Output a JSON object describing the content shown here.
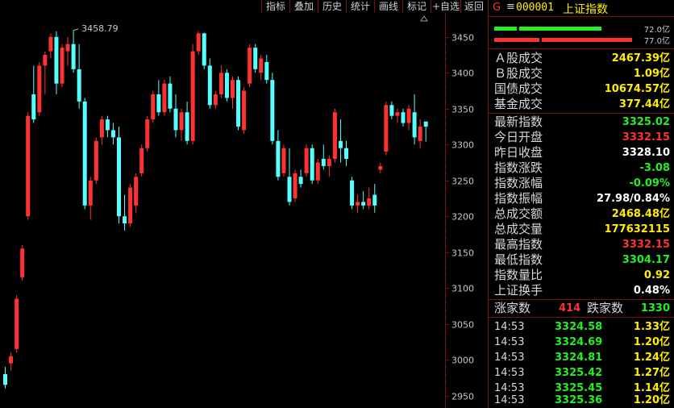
{
  "toolbar": {
    "buttons": [
      "指标",
      "叠加",
      "历史",
      "统计",
      "画线",
      "标记",
      "+自选",
      "返回"
    ]
  },
  "chart": {
    "annotation": "3458.79",
    "axis_labels": [
      "3450",
      "3400",
      "3350",
      "3300",
      "3250",
      "3200",
      "3150",
      "3100",
      "3050",
      "3000",
      "2950"
    ],
    "colors": {
      "up": "#ff3232",
      "down": "#54ffff",
      "grid": "#7a1010",
      "axis_text": "#c8c8c8"
    }
  },
  "chart_data": {
    "type": "candlestick",
    "ylim": [
      2935,
      3470
    ],
    "y_ticks": [
      3450,
      3400,
      3350,
      3300,
      3250,
      3200,
      3150,
      3100,
      3050,
      2950,
      3000
    ],
    "candles": [
      {
        "o": 2980,
        "h": 2990,
        "l": 2960,
        "c": 2965
      },
      {
        "o": 2995,
        "h": 3010,
        "l": 2985,
        "c": 3005
      },
      {
        "o": 3015,
        "h": 3090,
        "l": 3010,
        "c": 3085
      },
      {
        "o": 3115,
        "h": 3160,
        "l": 3110,
        "c": 3155
      },
      {
        "o": 3200,
        "h": 3345,
        "l": 3195,
        "c": 3340
      },
      {
        "o": 3370,
        "h": 3410,
        "l": 3330,
        "c": 3335
      },
      {
        "o": 3345,
        "h": 3415,
        "l": 3340,
        "c": 3410
      },
      {
        "o": 3410,
        "h": 3430,
        "l": 3370,
        "c": 3425
      },
      {
        "o": 3430,
        "h": 3455,
        "l": 3420,
        "c": 3450
      },
      {
        "o": 3450,
        "h": 3458,
        "l": 3370,
        "c": 3385
      },
      {
        "o": 3385,
        "h": 3440,
        "l": 3380,
        "c": 3435
      },
      {
        "o": 3430,
        "h": 3450,
        "l": 3410,
        "c": 3440
      },
      {
        "o": 3440,
        "h": 3459,
        "l": 3400,
        "c": 3405
      },
      {
        "o": 3405,
        "h": 3440,
        "l": 3350,
        "c": 3360
      },
      {
        "o": 3360,
        "h": 3365,
        "l": 3210,
        "c": 3215
      },
      {
        "o": 3215,
        "h": 3255,
        "l": 3195,
        "c": 3250
      },
      {
        "o": 3250,
        "h": 3310,
        "l": 3245,
        "c": 3305
      },
      {
        "o": 3310,
        "h": 3340,
        "l": 3300,
        "c": 3335
      },
      {
        "o": 3335,
        "h": 3340,
        "l": 3310,
        "c": 3320
      },
      {
        "o": 3320,
        "h": 3330,
        "l": 3300,
        "c": 3310
      },
      {
        "o": 3310,
        "h": 3325,
        "l": 3190,
        "c": 3200
      },
      {
        "o": 3200,
        "h": 3230,
        "l": 3180,
        "c": 3190
      },
      {
        "o": 3190,
        "h": 3245,
        "l": 3185,
        "c": 3240
      },
      {
        "o": 3215,
        "h": 3260,
        "l": 3205,
        "c": 3255
      },
      {
        "o": 3260,
        "h": 3300,
        "l": 3255,
        "c": 3295
      },
      {
        "o": 3295,
        "h": 3340,
        "l": 3290,
        "c": 3335
      },
      {
        "o": 3335,
        "h": 3375,
        "l": 3330,
        "c": 3370
      },
      {
        "o": 3370,
        "h": 3390,
        "l": 3340,
        "c": 3345
      },
      {
        "o": 3345,
        "h": 3390,
        "l": 3340,
        "c": 3385
      },
      {
        "o": 3385,
        "h": 3395,
        "l": 3345,
        "c": 3350
      },
      {
        "o": 3350,
        "h": 3370,
        "l": 3310,
        "c": 3320
      },
      {
        "o": 3320,
        "h": 3350,
        "l": 3305,
        "c": 3345
      },
      {
        "o": 3345,
        "h": 3360,
        "l": 3300,
        "c": 3305
      },
      {
        "o": 3305,
        "h": 3440,
        "l": 3300,
        "c": 3430
      },
      {
        "o": 3430,
        "h": 3458,
        "l": 3425,
        "c": 3455
      },
      {
        "o": 3455,
        "h": 3456,
        "l": 3405,
        "c": 3410
      },
      {
        "o": 3410,
        "h": 3420,
        "l": 3350,
        "c": 3355
      },
      {
        "o": 3355,
        "h": 3375,
        "l": 3350,
        "c": 3370
      },
      {
        "o": 3370,
        "h": 3410,
        "l": 3365,
        "c": 3400
      },
      {
        "o": 3400,
        "h": 3405,
        "l": 3360,
        "c": 3365
      },
      {
        "o": 3365,
        "h": 3395,
        "l": 3350,
        "c": 3390
      },
      {
        "o": 3390,
        "h": 3395,
        "l": 3320,
        "c": 3325
      },
      {
        "o": 3320,
        "h": 3380,
        "l": 3315,
        "c": 3375
      },
      {
        "o": 3385,
        "h": 3440,
        "l": 3380,
        "c": 3435
      },
      {
        "o": 3435,
        "h": 3440,
        "l": 3400,
        "c": 3405
      },
      {
        "o": 3400,
        "h": 3425,
        "l": 3390,
        "c": 3420
      },
      {
        "o": 3415,
        "h": 3425,
        "l": 3385,
        "c": 3390
      },
      {
        "o": 3390,
        "h": 3400,
        "l": 3300,
        "c": 3305
      },
      {
        "o": 3305,
        "h": 3320,
        "l": 3250,
        "c": 3255
      },
      {
        "o": 3260,
        "h": 3300,
        "l": 3255,
        "c": 3295
      },
      {
        "o": 3255,
        "h": 3295,
        "l": 3215,
        "c": 3220
      },
      {
        "o": 3225,
        "h": 3265,
        "l": 3220,
        "c": 3260
      },
      {
        "o": 3255,
        "h": 3265,
        "l": 3240,
        "c": 3245
      },
      {
        "o": 3260,
        "h": 3300,
        "l": 3255,
        "c": 3295
      },
      {
        "o": 3295,
        "h": 3300,
        "l": 3245,
        "c": 3250
      },
      {
        "o": 3250,
        "h": 3280,
        "l": 3245,
        "c": 3275
      },
      {
        "o": 3280,
        "h": 3300,
        "l": 3265,
        "c": 3270
      },
      {
        "o": 3270,
        "h": 3285,
        "l": 3255,
        "c": 3280
      },
      {
        "o": 3280,
        "h": 3350,
        "l": 3275,
        "c": 3345
      },
      {
        "o": 3305,
        "h": 3335,
        "l": 3275,
        "c": 3295
      },
      {
        "o": 3295,
        "h": 3305,
        "l": 3270,
        "c": 3280
      },
      {
        "o": 3250,
        "h": 3255,
        "l": 3210,
        "c": 3215
      },
      {
        "o": 3215,
        "h": 3230,
        "l": 3205,
        "c": 3220
      },
      {
        "o": 3220,
        "h": 3235,
        "l": 3210,
        "c": 3215
      },
      {
        "o": 3215,
        "h": 3240,
        "l": 3210,
        "c": 3225
      },
      {
        "o": 3230,
        "h": 3245,
        "l": 3205,
        "c": 3215
      },
      {
        "o": 3265,
        "h": 3275,
        "l": 3260,
        "c": 3270
      },
      {
        "o": 3290,
        "h": 3360,
        "l": 3285,
        "c": 3355
      },
      {
        "o": 3355,
        "h": 3360,
        "l": 3335,
        "c": 3340
      },
      {
        "o": 3340,
        "h": 3350,
        "l": 3330,
        "c": 3345
      },
      {
        "o": 3345,
        "h": 3350,
        "l": 3325,
        "c": 3330
      },
      {
        "o": 3330,
        "h": 3355,
        "l": 3320,
        "c": 3350
      },
      {
        "o": 3345,
        "h": 3370,
        "l": 3300,
        "c": 3310
      },
      {
        "o": 3305,
        "h": 3335,
        "l": 3295,
        "c": 3325
      },
      {
        "o": 3332,
        "h": 3332,
        "l": 3304,
        "c": 3325
      }
    ]
  },
  "side": {
    "header": {
      "g": "G",
      "menu": "≡",
      "code": "000001",
      "name": "上证指数"
    },
    "bars": {
      "top_label": "72.0亿",
      "bottom_label": "77.0亿"
    },
    "turnover": [
      {
        "label": "Ａ股成交",
        "value": "2467.39亿"
      },
      {
        "label": "Ｂ股成交",
        "value": "1.09亿"
      },
      {
        "label": "国债成交",
        "value": "10674.57亿"
      },
      {
        "label": "基金成交",
        "value": "377.44亿"
      }
    ],
    "stats": [
      {
        "label": "最新指数",
        "value": "3325.02",
        "color": "#22ee22"
      },
      {
        "label": "今日开盘",
        "value": "3332.15",
        "color": "#ff3232"
      },
      {
        "label": "昨日收盘",
        "value": "3328.10",
        "color": "#ffffff"
      },
      {
        "label": "指数涨跌",
        "value": "-3.08",
        "color": "#22ee22"
      },
      {
        "label": "指数涨幅",
        "value": "-0.09%",
        "color": "#22ee22"
      },
      {
        "label": "指数振幅",
        "value": "27.98/0.84%",
        "color": "#ffffff"
      },
      {
        "label": "总成交额",
        "value": "2468.48亿",
        "color": "#ffee00"
      },
      {
        "label": "总成交量",
        "value": "177632115",
        "color": "#ffee00"
      },
      {
        "label": "最高指数",
        "value": "3332.15",
        "color": "#ff3232"
      },
      {
        "label": "最低指数",
        "value": "3304.17",
        "color": "#22ee22"
      },
      {
        "label": "指数量比",
        "value": "0.92",
        "color": "#ffee00"
      },
      {
        "label": "上证换手",
        "value": "0.48%",
        "color": "#ffffff"
      }
    ],
    "breadth": {
      "up_label": "涨家数",
      "up_value": "414",
      "down_label": "跌家数",
      "down_value": "1330"
    },
    "ticks": [
      {
        "time": "14:53",
        "price": "3324.58",
        "amount": "1.33亿"
      },
      {
        "time": "14:53",
        "price": "3324.69",
        "amount": "1.20亿"
      },
      {
        "time": "14:53",
        "price": "3324.81",
        "amount": "1.24亿"
      },
      {
        "time": "14:53",
        "price": "3325.42",
        "amount": "1.27亿"
      },
      {
        "time": "14:53",
        "price": "3325.45",
        "amount": "1.14亿"
      },
      {
        "time": "14:53",
        "price": "3325.36",
        "amount": "1.20亿"
      }
    ]
  }
}
